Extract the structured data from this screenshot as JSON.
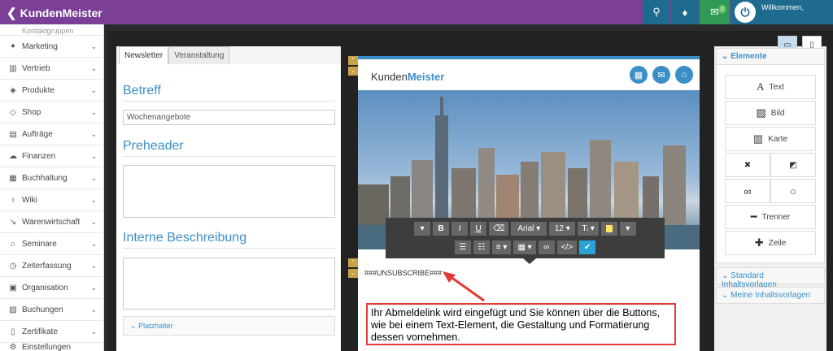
{
  "app": {
    "name": "KundenMeister",
    "welcome": "Willkommen,"
  },
  "topbar": {
    "notif_count": "0"
  },
  "sidebar": {
    "partial_label": "Kontaktgruppen",
    "items": [
      {
        "label": "Marketing",
        "icon": "megaphone-icon"
      },
      {
        "label": "Vertrieb",
        "icon": "chart-icon"
      },
      {
        "label": "Produkte",
        "icon": "box-icon"
      },
      {
        "label": "Shop",
        "icon": "tag-icon"
      },
      {
        "label": "Aufträge",
        "icon": "clipboard-icon"
      },
      {
        "label": "Finanzen",
        "icon": "money-icon"
      },
      {
        "label": "Buchhaltung",
        "icon": "table-icon"
      },
      {
        "label": "Wiki",
        "icon": "lightbulb-icon"
      },
      {
        "label": "Warenwirtschaft",
        "icon": "dolly-icon"
      },
      {
        "label": "Seminare",
        "icon": "graduation-icon"
      },
      {
        "label": "Zeiterfassung",
        "icon": "clock-icon"
      },
      {
        "label": "Organisation",
        "icon": "clipboard-check-icon"
      },
      {
        "label": "Buchungen",
        "icon": "calendar-icon"
      },
      {
        "label": "Zertifikate",
        "icon": "bookmark-icon"
      }
    ],
    "bottom_partial": "Einstellungen"
  },
  "tabs": [
    {
      "label": "Newsletter"
    },
    {
      "label": "Veranstaltung"
    }
  ],
  "form": {
    "betreff_label": "Betreff",
    "betreff_value": "Wochenangebote",
    "preheader_label": "Preheader",
    "interne_label": "Interne Beschreibung",
    "platzhalter_label": "Platzhalter"
  },
  "canvas": {
    "logo_plain": "Kunden",
    "logo_bold": "Meister",
    "unsubscribe": "###UNSUBSCRIBE###"
  },
  "toolbar": {
    "font": "Arial",
    "size": "12"
  },
  "note": "Ihr Abmeldelink wird eingefügt und Sie können über die Buttons, wie bei einem Text-Element, die Gestaltung und Formatierung dessen vornehmen.",
  "rightpanel": {
    "elemente_label": "Elemente",
    "text_label": "Text",
    "bild_label": "Bild",
    "karte_label": "Karte",
    "trenner_label": "Trenner",
    "zeile_label": "Zeile",
    "standard_label": "Standard Inhaltsvorlagen",
    "meine_label": "Meine Inhaltsvorlagen"
  }
}
